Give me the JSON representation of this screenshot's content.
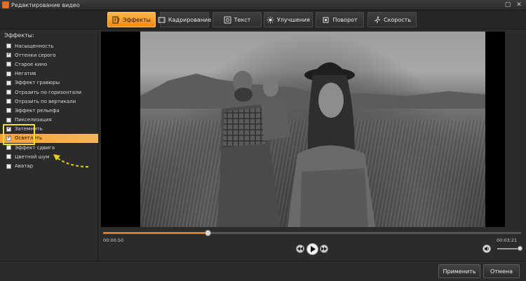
{
  "window": {
    "title": "Редактирование видео"
  },
  "toolbar": {
    "tabs": [
      {
        "label": "Эффекты",
        "icon": "effects-icon"
      },
      {
        "label": "Кадрирование",
        "icon": "crop-film-icon"
      },
      {
        "label": "Текст",
        "icon": "text-icon"
      },
      {
        "label": "Улучшения",
        "icon": "sun-icon"
      },
      {
        "label": "Поворот",
        "icon": "rotate-icon"
      },
      {
        "label": "Скорость",
        "icon": "runner-icon"
      }
    ],
    "active_tab": "Эффекты"
  },
  "effects_panel": {
    "title": "Эффекты:",
    "items": [
      {
        "label": "Насыщенность",
        "checked": false
      },
      {
        "label": "Оттенки серого",
        "checked": true
      },
      {
        "label": "Старое кино",
        "checked": false
      },
      {
        "label": "Негатив",
        "checked": false
      },
      {
        "label": "Эффект гравюры",
        "checked": false
      },
      {
        "label": "Отразить по горизонтали",
        "checked": false
      },
      {
        "label": "Отразить по вертикали",
        "checked": false
      },
      {
        "label": "Эффект рельефа",
        "checked": false
      },
      {
        "label": "Пикселизация",
        "checked": false
      },
      {
        "label": "Затемнить",
        "checked": true
      },
      {
        "label": "Осветлить",
        "checked": true
      },
      {
        "label": "Эффект сдвига",
        "checked": false
      },
      {
        "label": "Цветной шум",
        "checked": false
      },
      {
        "label": "Аватар",
        "checked": false
      }
    ],
    "selected_index": 10
  },
  "player": {
    "current_time": "00:00:50",
    "total_time": "00:03:21",
    "progress": 0.25,
    "volume": 0.95
  },
  "colors": {
    "accent": "#f08a12",
    "highlight": "#f5e31a",
    "background": "#2b2b2b"
  },
  "footer": {
    "apply_label": "Применить",
    "cancel_label": "Отмена"
  }
}
